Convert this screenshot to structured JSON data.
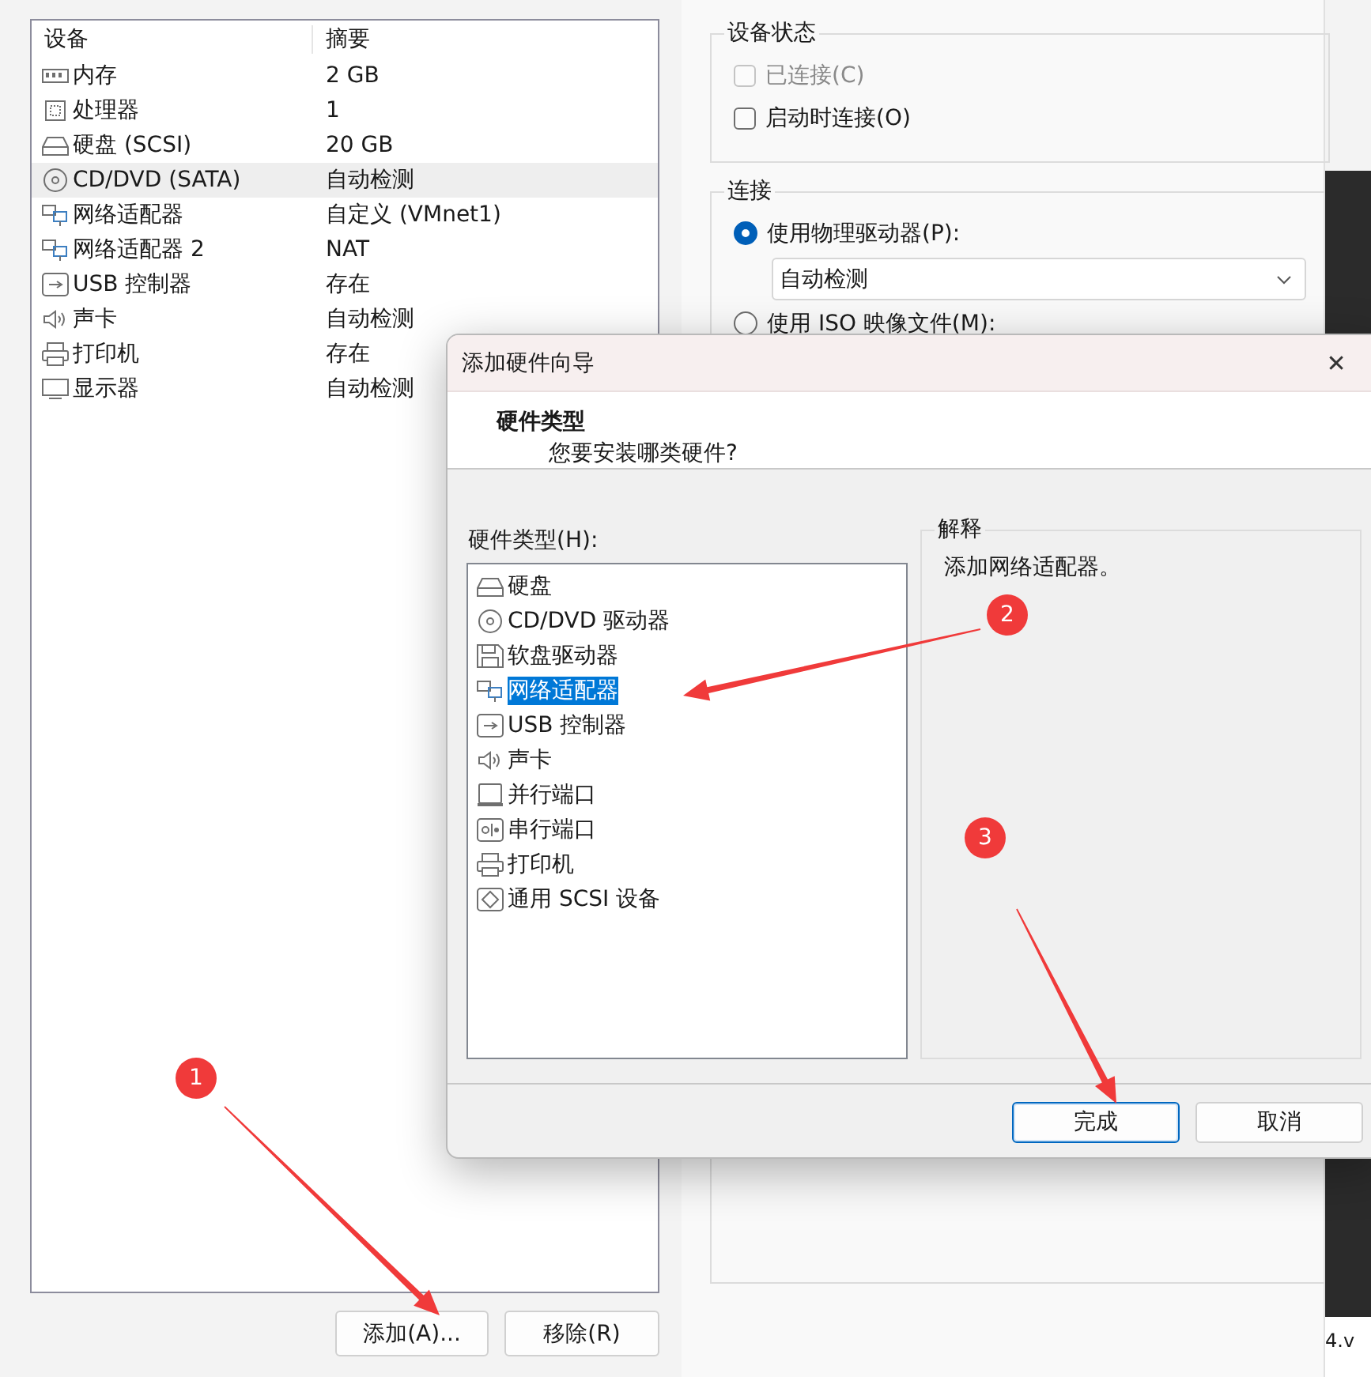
{
  "device_list": {
    "columns": [
      "设备",
      "摘要"
    ],
    "rows": [
      {
        "kind": "memory",
        "device": "内存",
        "summary": "2 GB",
        "selected": false
      },
      {
        "kind": "cpu",
        "device": "处理器",
        "summary": "1",
        "selected": false
      },
      {
        "kind": "disk",
        "device": "硬盘 (SCSI)",
        "summary": "20 GB",
        "selected": false
      },
      {
        "kind": "cd",
        "device": "CD/DVD (SATA)",
        "summary": "自动检测",
        "selected": true
      },
      {
        "kind": "network",
        "device": "网络适配器",
        "summary": "自定义 (VMnet1)",
        "selected": false
      },
      {
        "kind": "network",
        "device": "网络适配器 2",
        "summary": "NAT",
        "selected": false
      },
      {
        "kind": "usb",
        "device": "USB 控制器",
        "summary": "存在",
        "selected": false
      },
      {
        "kind": "sound",
        "device": "声卡",
        "summary": "自动检测",
        "selected": false
      },
      {
        "kind": "printer",
        "device": "打印机",
        "summary": "存在",
        "selected": false
      },
      {
        "kind": "display",
        "device": "显示器",
        "summary": "自动检测",
        "selected": false
      }
    ]
  },
  "list_buttons": [
    "添加(A)...",
    "移除(R)"
  ],
  "device_status": {
    "title": "设备状态",
    "items": [
      {
        "label": "已连接(C)",
        "checked": false,
        "disabled": true
      },
      {
        "label": "启动时连接(O)",
        "checked": false,
        "disabled": false
      }
    ]
  },
  "connection": {
    "title": "连接",
    "options": [
      {
        "label": "使用物理驱动器(P):",
        "selected": true
      },
      {
        "label": "使用 ISO 映像文件(M):",
        "selected": false
      }
    ],
    "dropdown": {
      "value": "自动检测"
    }
  },
  "edge_text": "4.v",
  "dialog": {
    "title": "添加硬件向导",
    "close": "✕",
    "header_title": "硬件类型",
    "header_subtitle": "您要安装哪类硬件?",
    "list_label": "硬件类型(H):",
    "hardware": [
      {
        "kind": "disk",
        "label": "硬盘",
        "selected": false
      },
      {
        "kind": "cd",
        "label": "CD/DVD 驱动器",
        "selected": false
      },
      {
        "kind": "floppy",
        "label": "软盘驱动器",
        "selected": false
      },
      {
        "kind": "network",
        "label": "网络适配器",
        "selected": true
      },
      {
        "kind": "usb",
        "label": "USB 控制器",
        "selected": false
      },
      {
        "kind": "sound",
        "label": "声卡",
        "selected": false
      },
      {
        "kind": "parallel",
        "label": "并行端口",
        "selected": false
      },
      {
        "kind": "serial",
        "label": "串行端口",
        "selected": false
      },
      {
        "kind": "printer",
        "label": "打印机",
        "selected": false
      },
      {
        "kind": "scsi",
        "label": "通用 SCSI 设备",
        "selected": false
      }
    ],
    "explanation": {
      "title": "解释",
      "text": "添加网络适配器。"
    },
    "buttons": [
      {
        "label": "完成",
        "default": true
      },
      {
        "label": "取消",
        "default": false
      }
    ]
  },
  "annotations": [
    {
      "label": "1"
    },
    {
      "label": "2"
    },
    {
      "label": "3"
    }
  ]
}
